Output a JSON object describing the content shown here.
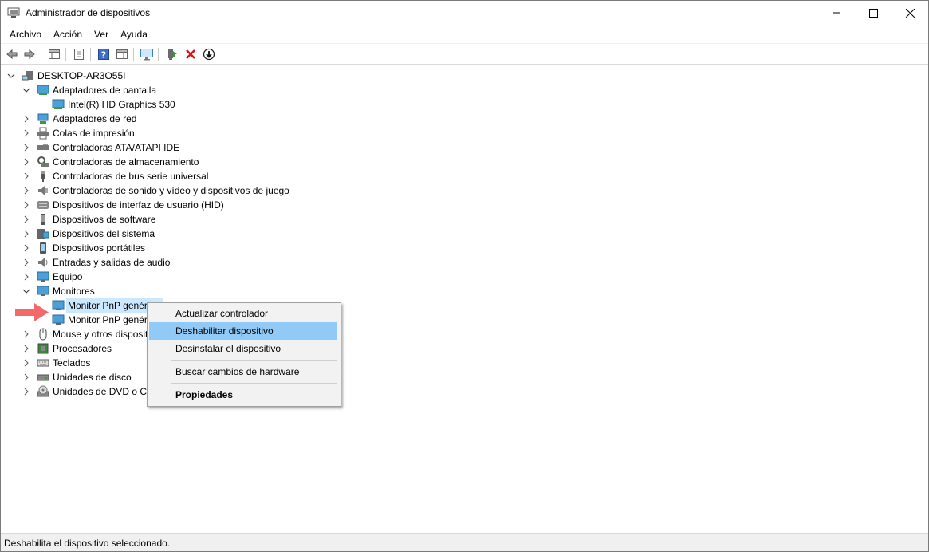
{
  "window": {
    "title": "Administrador de dispositivos"
  },
  "menu": [
    "Archivo",
    "Acción",
    "Ver",
    "Ayuda"
  ],
  "tree": {
    "root": "DESKTOP-AR3O55I",
    "items": [
      "Adaptadores de pantalla",
      "Intel(R) HD Graphics 530",
      "Adaptadores de red",
      "Colas de impresión",
      "Controladoras ATA/ATAPI IDE",
      "Controladoras de almacenamiento",
      "Controladoras de bus serie universal",
      "Controladoras de sonido y vídeo y dispositivos de juego",
      "Dispositivos de interfaz de usuario (HID)",
      "Dispositivos de software",
      "Dispositivos del sistema",
      "Dispositivos portátiles",
      "Entradas y salidas de audio",
      "Equipo",
      "Monitores",
      "Monitor PnP genér",
      "Monitor PnP genér",
      "Mouse y otros disposit",
      "Procesadores",
      "Teclados",
      "Unidades de disco",
      "Unidades de DVD o CD"
    ]
  },
  "context_menu": {
    "update_driver": "Actualizar controlador",
    "disable_device": "Deshabilitar dispositivo",
    "uninstall_device": "Desinstalar el dispositivo",
    "scan_hardware": "Buscar cambios de hardware",
    "properties": "Propiedades"
  },
  "status": "Deshabilita el dispositivo seleccionado.",
  "colors": {
    "selection": "#cce8ff",
    "menu_highlight": "#91c9f7",
    "arrow": "#f2696a"
  }
}
